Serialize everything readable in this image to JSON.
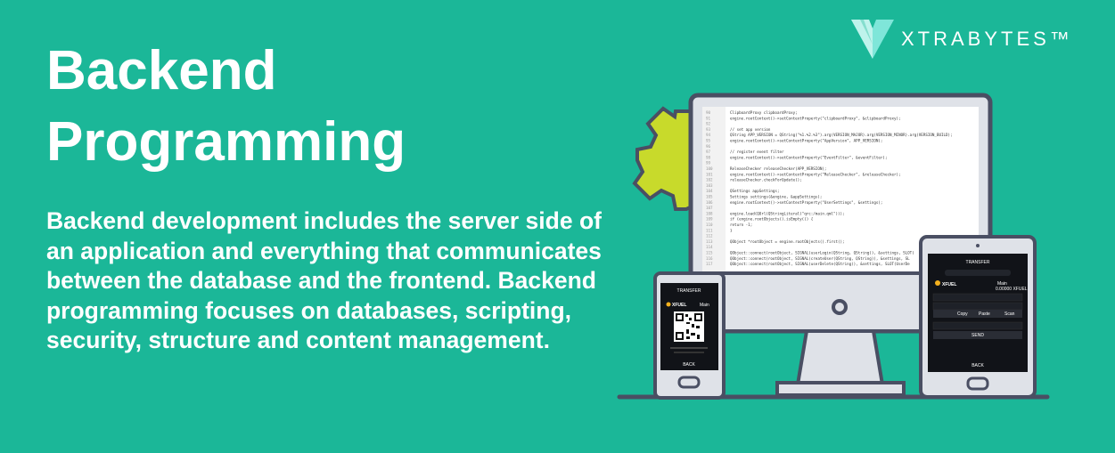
{
  "brand": {
    "name": "XTRABYTES™"
  },
  "heading": {
    "line1": "Backend",
    "line2": "Programming"
  },
  "description": "Backend development includes the server side of an application and everything that communicates between the database and the frontend. Backend programming focuses on databases, scripting, security, structure and content management.",
  "colors": {
    "background": "#1bb798",
    "device_frame": "#4a4f63",
    "gear": "#c8da2b"
  },
  "monitor": {
    "code_lines": [
      "ClipboardProxy clipboardProxy;",
      "engine.rootContext()->setContextProperty(\"clipboardProxy\", &clipboardProxy);",
      "",
      "// set app version",
      "QString APP_VERSION = QString(\"%1.%2.%3\").arg(VERSION_MAJOR).arg(VERSION_MINOR).arg(VERSION_BUILD);",
      "engine.rootContext()->setContextProperty(\"AppVersion\", APP_VERSION);",
      "",
      "// register event filter",
      "engine.rootContext()->setContextProperty(\"EventFilter\", &eventFilter);",
      "",
      "ReleaseChecker releaseChecker(APP_VERSION);",
      "engine.rootContext()->setContextProperty(\"ReleaseChecker\", &releaseChecker);",
      "releaseChecker.checkForUpdate();",
      "",
      "QSettings appSettings;",
      "Settings settings(&engine, &appSettings);",
      "engine.rootContext()->setContextProperty(\"UserSettings\", &settings);",
      "",
      "engine.load(QUrl(QStringLiteral(\"qrc:/main.qml\")));",
      "if (engine.rootObjects().isEmpty()) {",
      "    return -1;",
      "}",
      "",
      "QObject *rootObject = engine.rootObjects().first();",
      "",
      "QObject::connect(rootObject, SIGNAL(userLogin(QString, QString)), &settings, SLOT(",
      "QObject::connect(rootObject, SIGNAL(createUser(QString, QString)), &settings, SL",
      "QObject::connect(rootObject, SIGNAL(userDelete(QString)), &settings, SLOT(UserDe"
    ],
    "line_numbers": [
      "90",
      "91",
      "92",
      "93",
      "94",
      "95",
      "96",
      "97",
      "98",
      "99",
      "100",
      "101",
      "102",
      "103",
      "104",
      "105",
      "106",
      "107",
      "108",
      "109",
      "110",
      "111",
      "112",
      "113",
      "114",
      "115",
      "116",
      "117"
    ]
  },
  "phone": {
    "title": "TRANSFER",
    "coin": "XFUEL",
    "account": "Main",
    "button": "BACK"
  },
  "tablet": {
    "title": "TRANSFER",
    "coin": "XFUEL",
    "account": "Main",
    "balance": "0.00000 XFUEL",
    "actions": [
      "Copy",
      "Paste",
      "Scan"
    ],
    "send_button": "SEND",
    "button": "BACK"
  }
}
